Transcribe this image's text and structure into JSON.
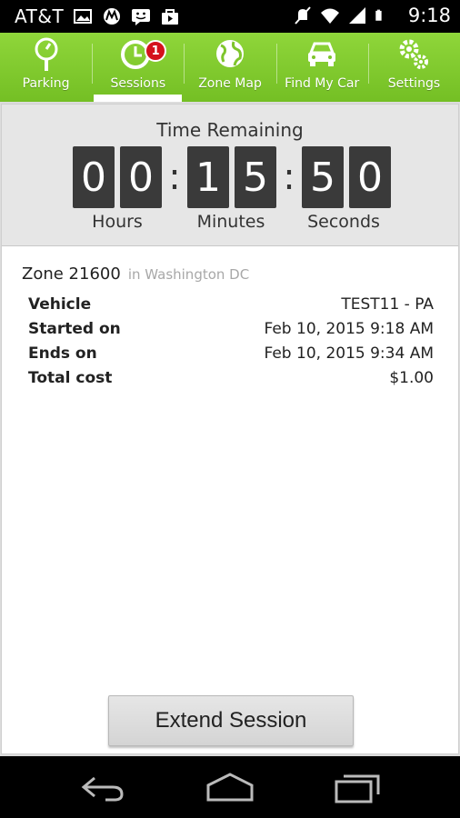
{
  "status_bar": {
    "carrier": "AT&T",
    "time": "9:18",
    "icons": [
      "image-icon",
      "motorola-icon",
      "messenger-icon",
      "bag-icon",
      "mute-icon",
      "wifi-icon",
      "signal-icon",
      "battery-icon"
    ]
  },
  "tabs": [
    {
      "label": "Parking",
      "icon": "parking-meter-icon",
      "active": false
    },
    {
      "label": "Sessions",
      "icon": "clock-icon",
      "active": true,
      "badge": "1"
    },
    {
      "label": "Zone Map",
      "icon": "globe-icon",
      "active": false
    },
    {
      "label": "Find My Car",
      "icon": "car-icon",
      "active": false
    },
    {
      "label": "Settings",
      "icon": "gears-icon",
      "active": false
    }
  ],
  "timer": {
    "title": "Time Remaining",
    "hours": [
      "0",
      "0"
    ],
    "minutes": [
      "1",
      "5"
    ],
    "seconds": [
      "5",
      "0"
    ],
    "separator": ":",
    "labels": {
      "hours": "Hours",
      "minutes": "Minutes",
      "seconds": "Seconds"
    }
  },
  "zone": {
    "name": "Zone 21600",
    "city": "in Washington DC"
  },
  "details": [
    {
      "label": "Vehicle",
      "value": "TEST11 - PA"
    },
    {
      "label": "Started on",
      "value": "Feb 10, 2015 9:18 AM"
    },
    {
      "label": "Ends on",
      "value": "Feb 10, 2015 9:34 AM"
    },
    {
      "label": "Total cost",
      "value": "$1.00"
    }
  ],
  "actions": {
    "extend_label": "Extend Session"
  },
  "colors": {
    "accent_green": "#7ec52c",
    "badge_red": "#d4121c",
    "digit_bg": "#3a3a3a"
  }
}
